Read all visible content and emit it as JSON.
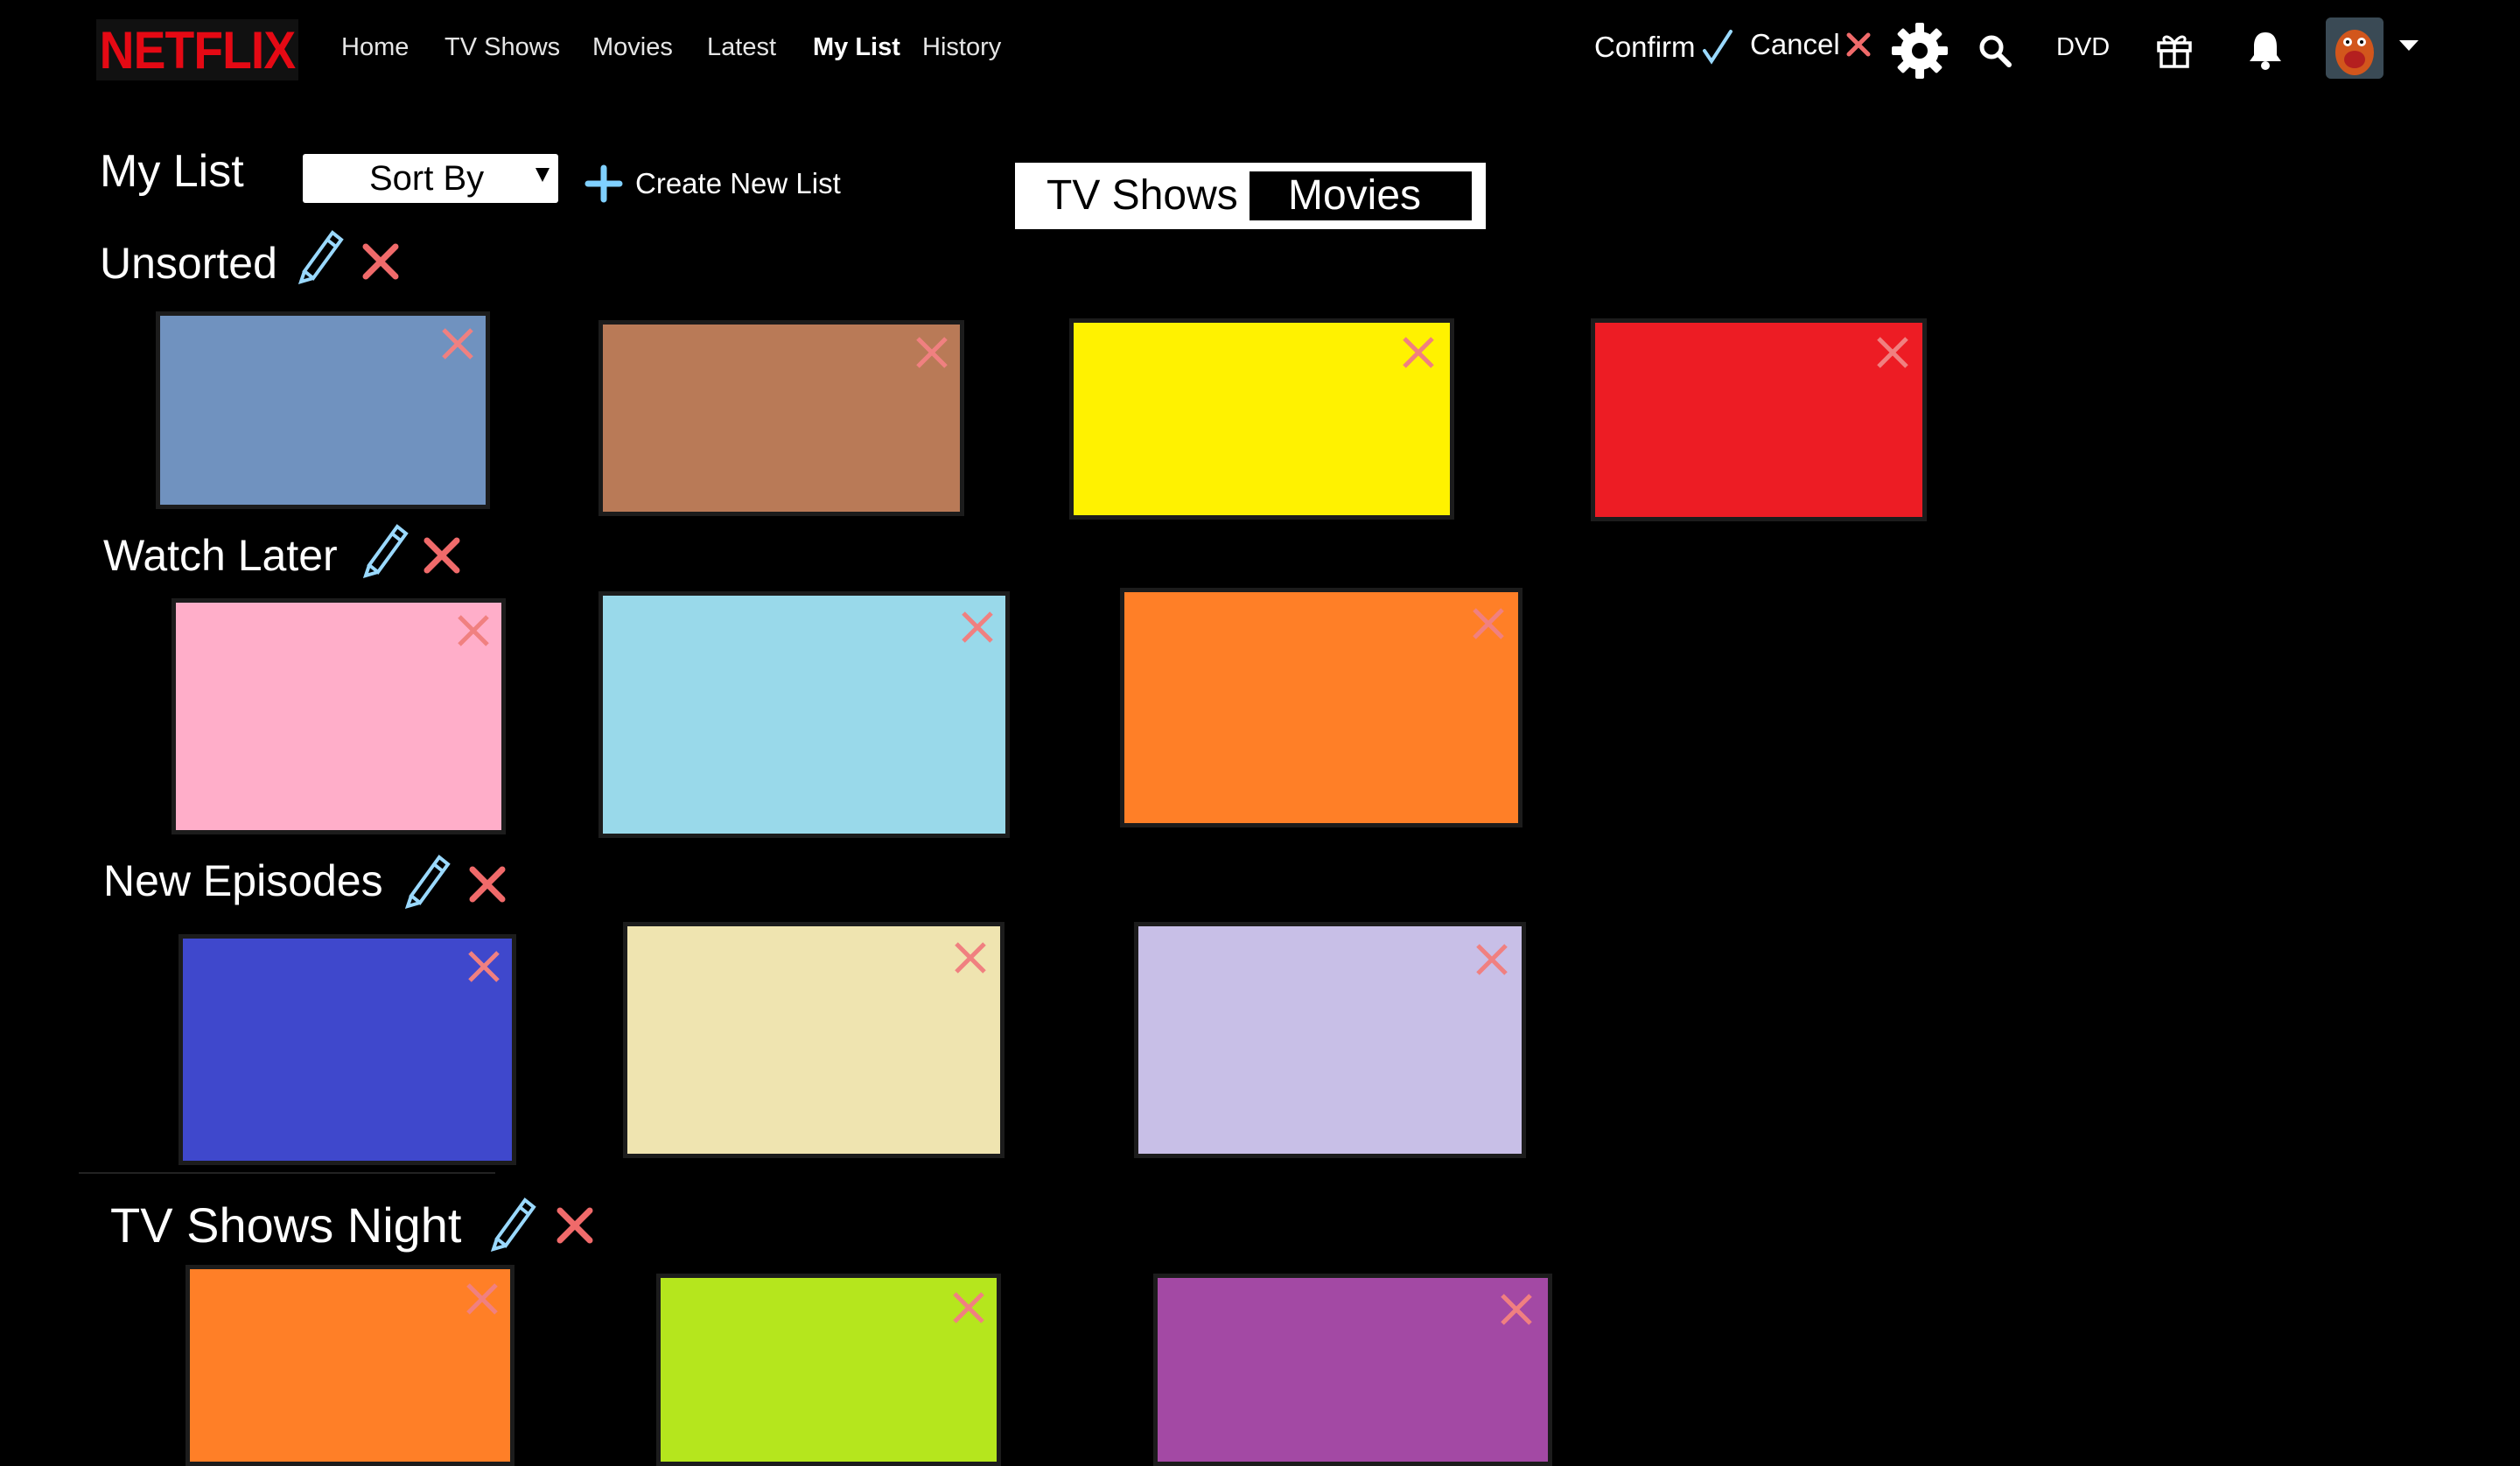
{
  "brand": {
    "logo_text": "NETFLIX",
    "color": "#e50914"
  },
  "nav": {
    "home": "Home",
    "tv_shows": "TV Shows",
    "movies": "Movies",
    "latest": "Latest",
    "my_list": "My List",
    "history": "History"
  },
  "top_actions": {
    "confirm": "Confirm",
    "cancel": "Cancel",
    "dvd": "DVD",
    "icons": [
      "settings-gear-icon",
      "search-icon",
      "gift-icon",
      "bell-icon",
      "avatar",
      "chevron-down-icon"
    ]
  },
  "controls": {
    "page_title": "My List",
    "sort_label": "Sort By",
    "create_new_list": "Create New List",
    "toggle_tv": "TV Shows",
    "toggle_movies": "Movies",
    "active_toggle": "Movies"
  },
  "lists": [
    {
      "title": "Unsorted",
      "items": [
        {
          "color": "#7092bf"
        },
        {
          "color": "#b97a57"
        },
        {
          "color": "#fff200"
        },
        {
          "color": "#ed1c24"
        }
      ]
    },
    {
      "title": "Watch Later",
      "items": [
        {
          "color": "#ffaec9"
        },
        {
          "color": "#99d9ea"
        },
        {
          "color": "#ff7f27"
        }
      ]
    },
    {
      "title": "New Episodes",
      "items": [
        {
          "color": "#3f48cc"
        },
        {
          "color": "#efe4b0"
        },
        {
          "color": "#c8bfe7"
        }
      ]
    },
    {
      "title": "TV Shows Night",
      "items": [
        {
          "color": "#ff7f27"
        },
        {
          "color": "#b5e61d"
        },
        {
          "color": "#a349a4"
        }
      ]
    }
  ],
  "colors": {
    "accent_blue": "#9ad9ff",
    "delete_red": "#f06a6a",
    "background": "#000000"
  }
}
